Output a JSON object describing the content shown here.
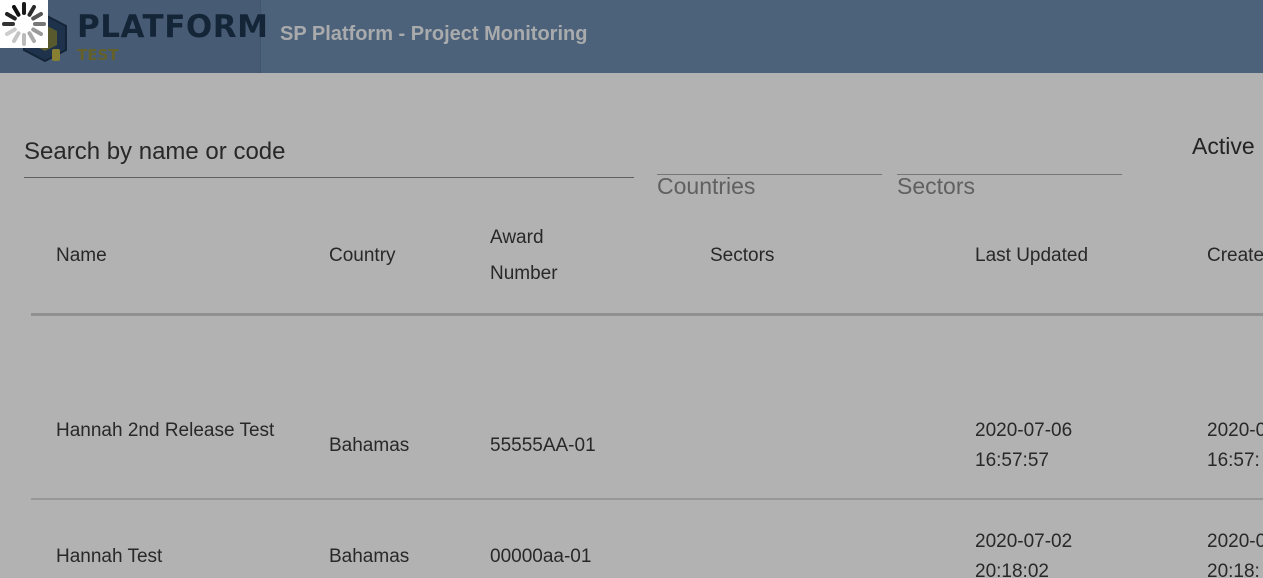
{
  "header": {
    "logo_text": "PLATFORM",
    "logo_sub": "TEST",
    "title": "SP Platform - Project Monitoring"
  },
  "filters": {
    "search_placeholder": "Search by name or code",
    "countries_label": "Countries",
    "sectors_label": "Sectors",
    "active_label": "Active"
  },
  "table": {
    "columns": [
      "Name",
      "Country",
      "Award Number",
      "Sectors",
      "Last Updated",
      "Create"
    ],
    "rows": [
      {
        "name": "Hannah 2nd Release Test",
        "country": "Bahamas",
        "award_number": "55555AA-01",
        "sectors": "",
        "last_updated": "2020-07-06 16:57:57",
        "created": "2020-0 16:57:"
      },
      {
        "name": "Hannah Test",
        "country": "Bahamas",
        "award_number": "00000aa-01",
        "sectors": "",
        "last_updated": "2020-07-02 20:18:02",
        "created": "2020-0 20:18:"
      }
    ]
  },
  "colors": {
    "header_bg": "#6c8daf",
    "logo_text": "#1e3550",
    "logo_sub": "#8f8a3c",
    "overlay": "rgba(0,0,0,0.30)"
  },
  "icons": {
    "logo": "hexagon-logo-icon",
    "loading": "loading-spinner-icon"
  }
}
